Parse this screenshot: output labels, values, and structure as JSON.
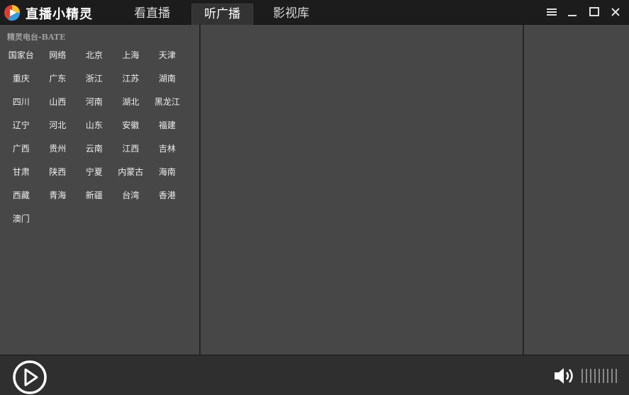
{
  "app": {
    "title": "直播小精灵",
    "colors": {
      "titlebar": "#1c1c1c",
      "panel": "#474747",
      "bottombar": "#2f2f2f",
      "text": "#eeeeee"
    }
  },
  "tabs": [
    {
      "label": "看直播",
      "active": false
    },
    {
      "label": "听广播",
      "active": true
    },
    {
      "label": "影视库",
      "active": false
    }
  ],
  "window_controls": {
    "icons": [
      "menu-icon",
      "minimize-icon",
      "maximize-icon",
      "close-icon"
    ]
  },
  "radio": {
    "section_title": "精灵电台-BATE",
    "regions": [
      "国家台",
      "网络",
      "北京",
      "上海",
      "天津",
      "重庆",
      "广东",
      "浙江",
      "江苏",
      "湖南",
      "四川",
      "山西",
      "河南",
      "湖北",
      "黑龙江",
      "辽宁",
      "河北",
      "山东",
      "安徽",
      "福建",
      "广西",
      "贵州",
      "云南",
      "江西",
      "吉林",
      "甘肃",
      "陕西",
      "宁夏",
      "内蒙古",
      "海南",
      "西藏",
      "青海",
      "新疆",
      "台湾",
      "香港",
      "澳门"
    ]
  },
  "player": {
    "play_icon": "play-icon",
    "volume_icon": "volume-icon",
    "volume_ticks": 9
  }
}
